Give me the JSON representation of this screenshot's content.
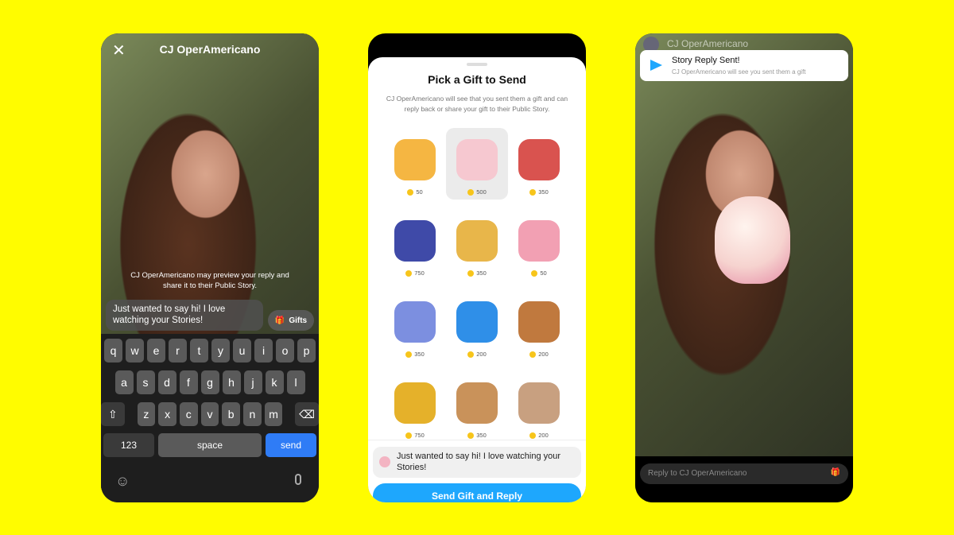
{
  "left_phone": {
    "title": "CJ OperAmericano",
    "close_icon": "✕",
    "preview_notice": "CJ OperAmericano may preview your reply and share it to their Public Story.",
    "message": "Just wanted to say hi! I love watching your Stories!",
    "gifts_label": "Gifts",
    "keyboard": {
      "row1": [
        "q",
        "w",
        "e",
        "r",
        "t",
        "y",
        "u",
        "i",
        "o",
        "p"
      ],
      "row2": [
        "a",
        "s",
        "d",
        "f",
        "g",
        "h",
        "j",
        "k",
        "l"
      ],
      "row3": [
        "z",
        "x",
        "c",
        "v",
        "b",
        "n",
        "m"
      ],
      "numbers": "123",
      "space": "space",
      "send": "send"
    }
  },
  "middle_phone": {
    "title": "Pick a Gift to Send",
    "description": "CJ OperAmericano will see that you sent them a gift and can reply back or share your gift to their Public Story.",
    "gifts": [
      {
        "name": "love-letter",
        "price": "50",
        "color": "#f5b642"
      },
      {
        "name": "unicorn",
        "price": "500",
        "color": "#f6c8d0",
        "selected": true
      },
      {
        "name": "rocket",
        "price": "350",
        "color": "#d9534f"
      },
      {
        "name": "vip-pass",
        "price": "750",
        "color": "#3f4aa8"
      },
      {
        "name": "clapping-trophy",
        "price": "350",
        "color": "#e8b64a"
      },
      {
        "name": "dropped-ice-cream",
        "price": "50",
        "color": "#f2a0b3"
      },
      {
        "name": "bouquet",
        "price": "350",
        "color": "#7c8fe0"
      },
      {
        "name": "sad-balloon",
        "price": "200",
        "color": "#2f8fe8"
      },
      {
        "name": "teddy-bear",
        "price": "200",
        "color": "#c0793e"
      },
      {
        "name": "gold-trophy",
        "price": "750",
        "color": "#e5b12a"
      },
      {
        "name": "pizza",
        "price": "350",
        "color": "#c9925a"
      },
      {
        "name": "coffee",
        "price": "200",
        "color": "#c8a080"
      }
    ],
    "reply_message": "Just wanted to say hi! I love watching your Stories!",
    "send_button": "Send Gift and Reply"
  },
  "right_phone": {
    "username": "CJ OperAmericano",
    "notification_title": "Story Reply Sent!",
    "notification_subtitle": "CJ OperAmericano will see you sent them a gift",
    "reply_placeholder": "Reply to CJ OperAmericano"
  },
  "colors": {
    "background": "#FFFC00",
    "accent": "#1EA7FD",
    "coin": "#F7C51B"
  }
}
